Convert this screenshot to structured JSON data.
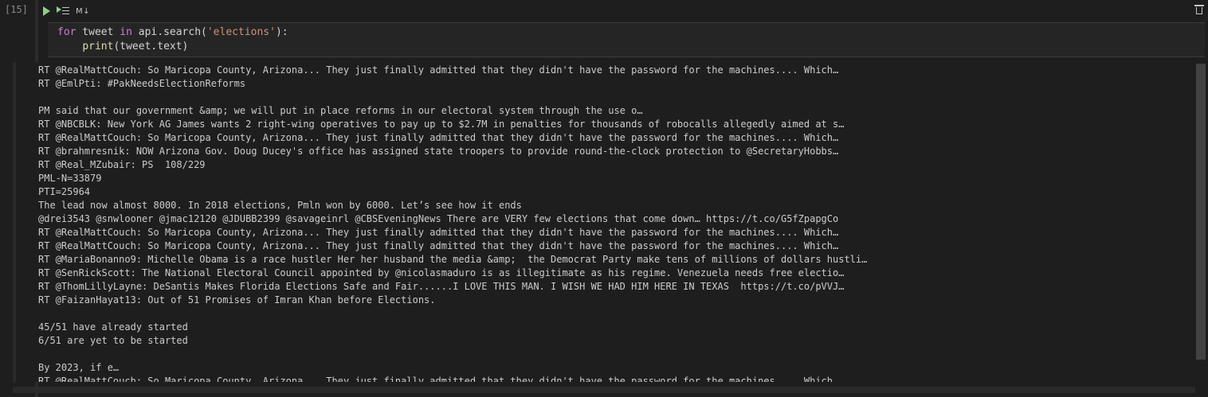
{
  "cell": {
    "execution_count": "[15]",
    "toolbar": {
      "run_icon": "play-icon",
      "run_below_icon": "run-below-icon",
      "markdown_label": "M↓",
      "delete_icon": "trash-icon"
    },
    "code": {
      "line1": {
        "kw1": "for",
        "t1": " tweet ",
        "kw2": "in",
        "t2": " api.search(",
        "str": "'elections'",
        "t3": "):"
      },
      "line2": {
        "indent": "    ",
        "fn": "print",
        "t1": "(tweet.text)"
      }
    }
  },
  "output": {
    "lines": [
      "RT @RealMattCouch: So Maricopa County, Arizona... They just finally admitted that they didn't have the password for the machines.... Which…",
      "RT @EmlPti: #PakNeedsElectionReforms",
      "",
      "PM said that our government &amp; we will put in place reforms in our electoral system through the use o…",
      "RT @NBCBLK: New York AG James wants 2 right-wing operatives to pay up to $2.7M in penalties for thousands of robocalls allegedly aimed at s…",
      "RT @RealMattCouch: So Maricopa County, Arizona... They just finally admitted that they didn't have the password for the machines.... Which…",
      "RT @brahmresnik: NOW Arizona Gov. Doug Ducey's office has assigned state troopers to provide round-the-clock protection to @SecretaryHobbs…",
      "RT @Real_MZubair: PS  108/229",
      "PML-N=33879",
      "PTI=25964",
      "The lead now almost 8000. In 2018 elections, Pmln won by 6000. Let’s see how it ends",
      "@drei3543 @snwlooner @jmac12120 @JDUBB2399 @savageinrl @CBSEveningNews There are VERY few elections that come down… https://t.co/G5fZpapgCo",
      "RT @RealMattCouch: So Maricopa County, Arizona... They just finally admitted that they didn't have the password for the machines.... Which…",
      "RT @RealMattCouch: So Maricopa County, Arizona... They just finally admitted that they didn't have the password for the machines.... Which…",
      "RT @MariaBonanno9: Michelle Obama is a race hustler Her her husband the media &amp;  the Democrat Party make tens of millions of dollars hustli…",
      "RT @SenRickScott: The National Electoral Council appointed by @nicolasmaduro is as illegitimate as his regime. Venezuela needs free electio…",
      "RT @ThomLillyLayne: DeSantis Makes Florida Elections Safe and Fair......I LOVE THIS MAN. I WISH WE HAD HIM HERE IN TEXAS  https://t.co/pVVJ…",
      "RT @FaizanHayat13: Out of 51 Promises of Imran Khan before Elections.",
      "",
      "45/51 have already started",
      "6/51 are yet to be started",
      "",
      "By 2023, if e…",
      "RT @RealMattCouch: So Maricopa County, Arizona... They just finally admitted that they didn't have the password for the machines.... Which…"
    ]
  }
}
